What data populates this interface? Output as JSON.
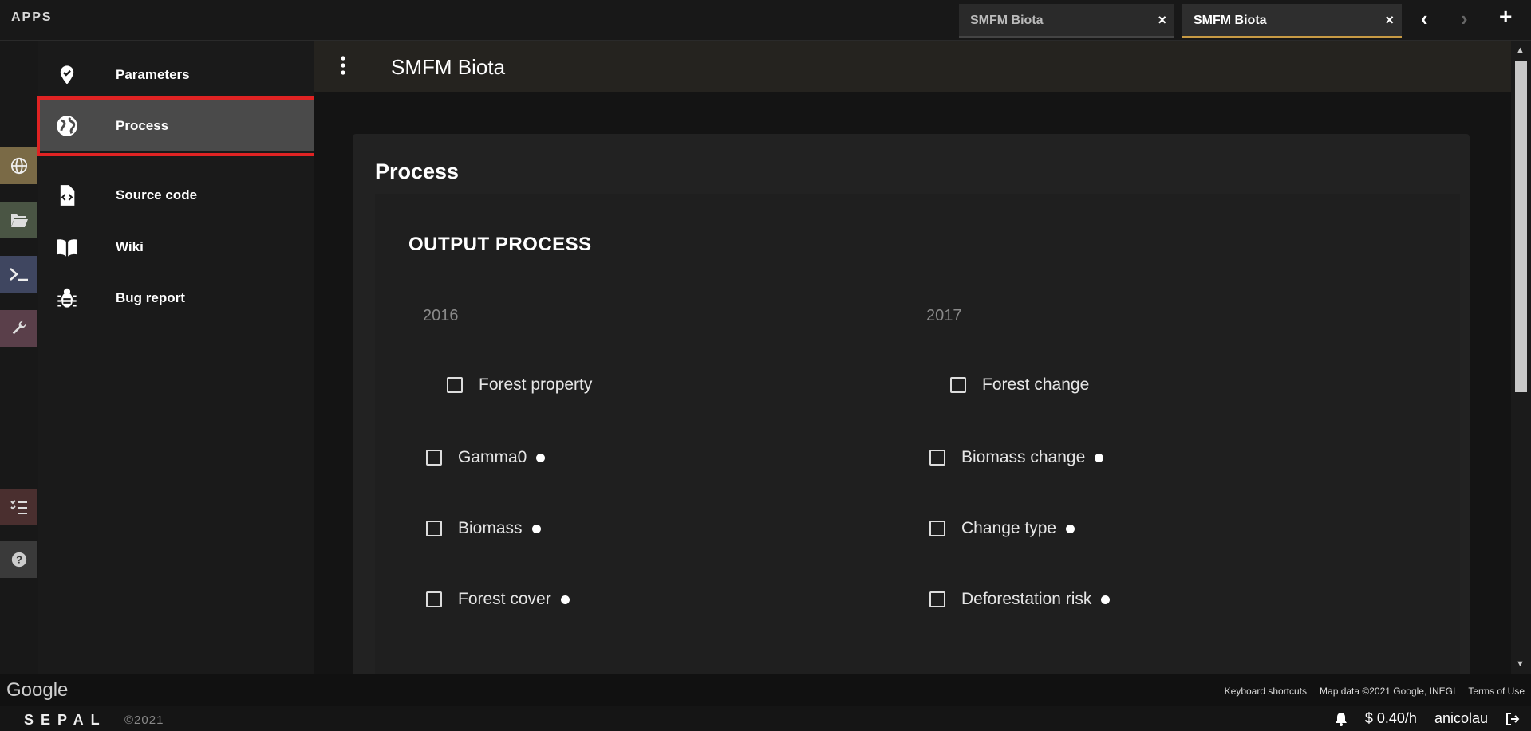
{
  "topbar": {
    "apps_label": "APPS",
    "tabs": [
      {
        "title": "SMFM Biota",
        "close": "×"
      },
      {
        "title": "SMFM Biota",
        "close": "×"
      }
    ],
    "nav": {
      "back": "‹",
      "forward": "›",
      "add": "+"
    }
  },
  "left_rail": {
    "icons": [
      "globe-icon",
      "folder-icon",
      "terminal-icon",
      "wrench-icon",
      "tasks-icon",
      "help-icon"
    ],
    "colors": [
      "#7a6a46",
      "#4a5544",
      "#3f4660",
      "#5a3f4a",
      "#4a2f2f",
      "#3a3a3a"
    ]
  },
  "sidebar": {
    "items": [
      {
        "label": "Parameters",
        "icon": "map-marker-check-icon"
      },
      {
        "label": "Process",
        "icon": "globe-icon"
      },
      {
        "label": "Source code",
        "icon": "file-code-icon"
      },
      {
        "label": "Wiki",
        "icon": "book-icon"
      },
      {
        "label": "Bug report",
        "icon": "bug-icon"
      }
    ],
    "selected": "Process",
    "highlight_color": "#e02323"
  },
  "appbar": {
    "title": "SMFM Biota"
  },
  "main": {
    "card_title": "Process",
    "section_title": "OUTPUT PROCESS",
    "columns": [
      {
        "year": "2016",
        "header_option": "Forest property",
        "options": [
          "Gamma0",
          "Biomass",
          "Forest cover"
        ]
      },
      {
        "year": "2017",
        "header_option": "Forest change",
        "options": [
          "Biomass change",
          "Change type",
          "Deforestation risk"
        ]
      }
    ]
  },
  "map_attribution": {
    "logo": "Google",
    "keyboard": "Keyboard shortcuts",
    "map_data": "Map data ©2021 Google, INEGI",
    "terms": "Terms of Use"
  },
  "footer": {
    "logo": "SEPAL",
    "copyright": "©2021",
    "rate": "0.40/h",
    "user": "anicolau"
  },
  "colors": {
    "accent": "#c79a44",
    "background": "#141414",
    "card": "#222222"
  }
}
